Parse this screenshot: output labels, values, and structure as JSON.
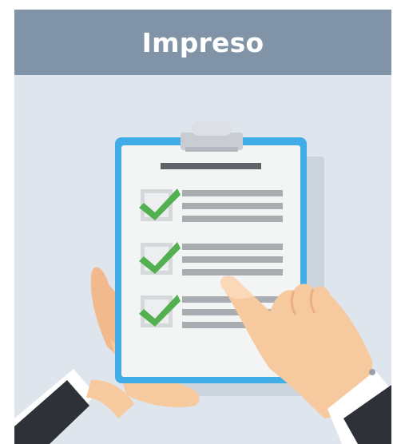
{
  "card": {
    "title": "Impreso"
  },
  "illustration": {
    "icons": [
      "clipboard-icon",
      "checkmark-icon",
      "pointing-hand-icon"
    ],
    "checklist_item_count": 3,
    "colors": {
      "header_bg": "#8193a7",
      "panel_bg": "#dfe5ec",
      "clipboard_frame": "#41ade6",
      "paper": "#f3f4f4",
      "check_green": "#52b050",
      "line_gray": "#a9adb1",
      "skin": "#f7c99e",
      "suit": "#2e3238"
    }
  }
}
